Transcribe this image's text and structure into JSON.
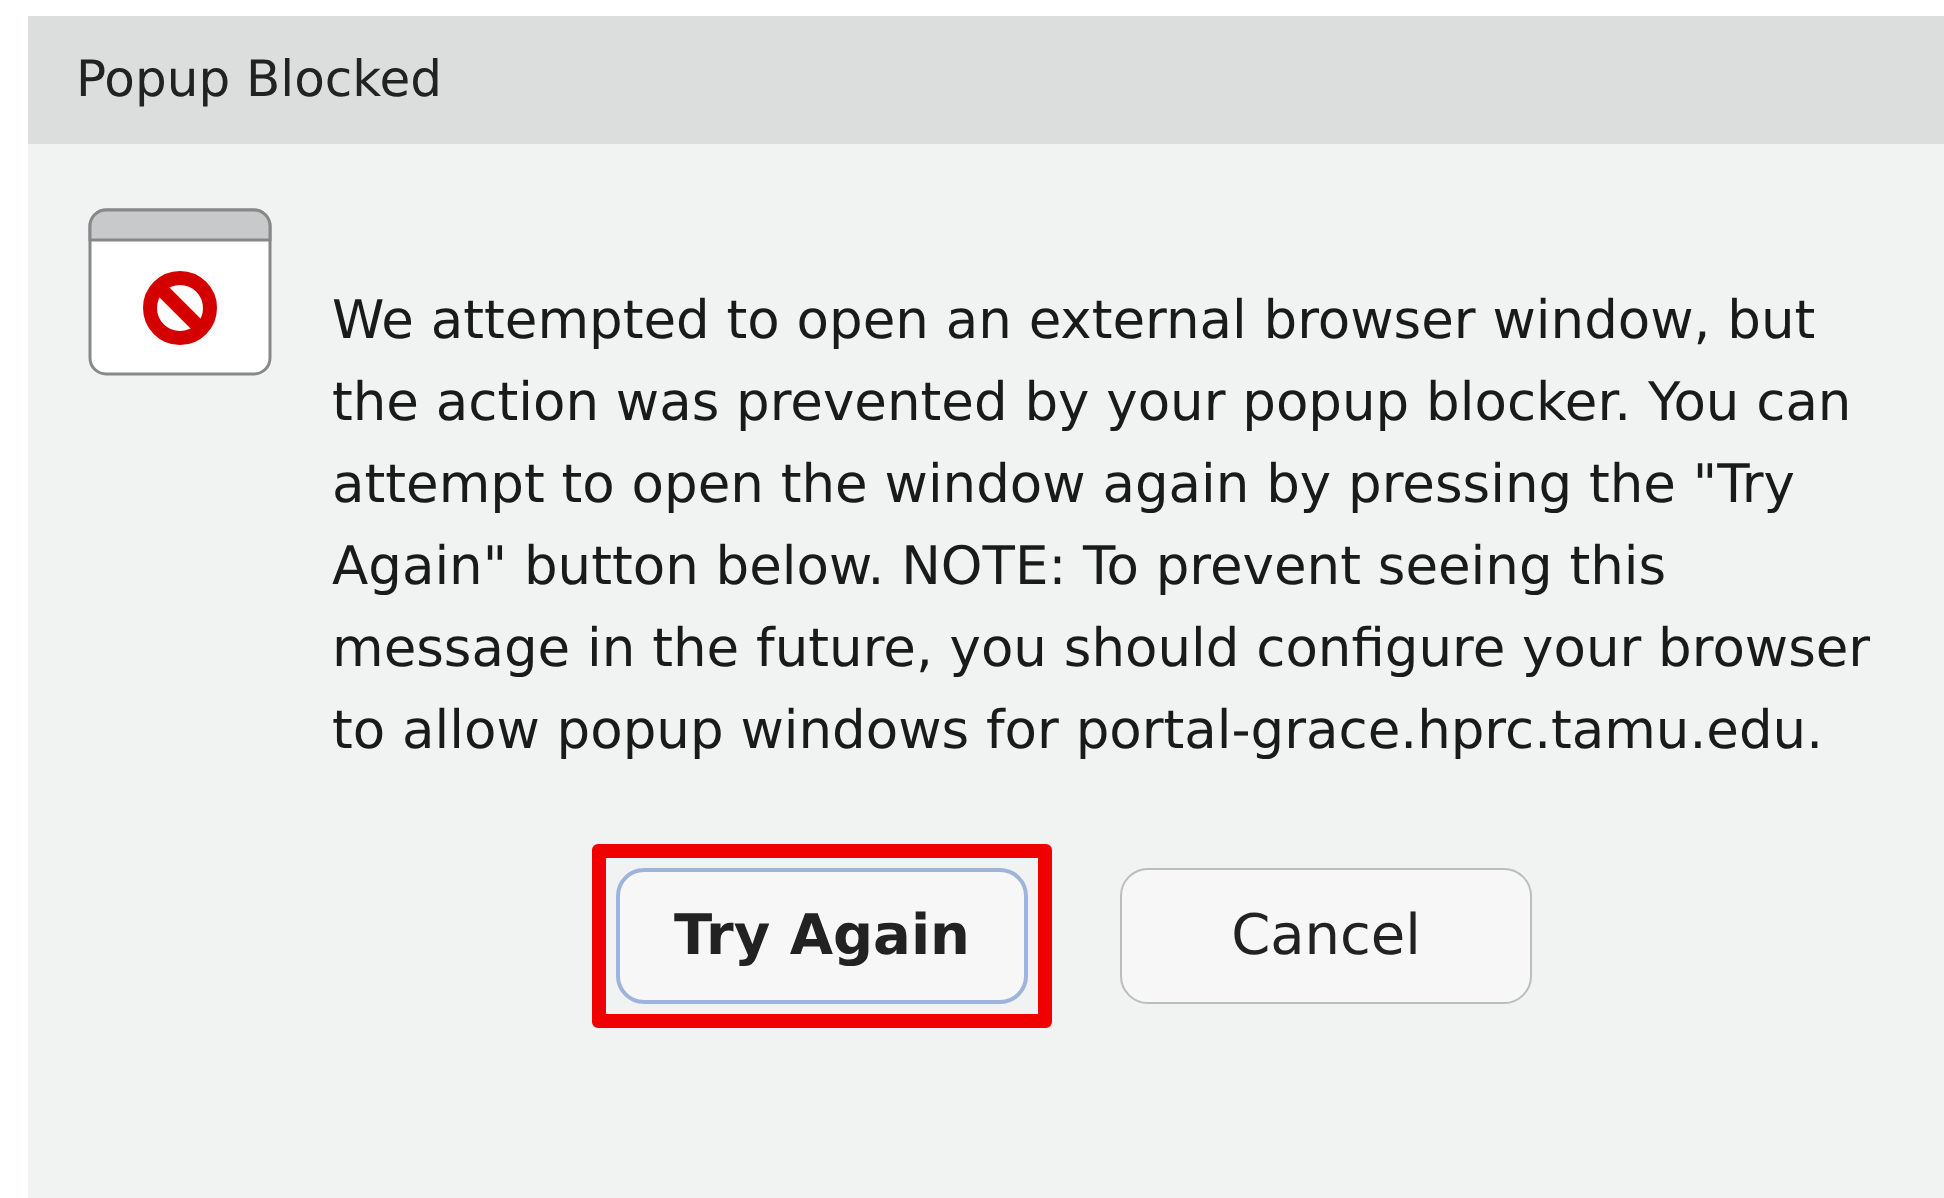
{
  "window": {
    "title": "Popup Blocked"
  },
  "message": "We attempted to open an external browser window, but the action was prevented by your popup blocker. You can attempt to open the window again by pressing the \"Try Again\" button below. NOTE: To prevent seeing this message in the future, you should configure your browser to allow popup windows for portal-grace.hprc.tamu.edu.",
  "buttons": [
    {
      "label": "Try Again",
      "focused": true,
      "highlighted": true
    },
    {
      "label": "Cancel",
      "focused": false,
      "highlighted": false
    }
  ]
}
